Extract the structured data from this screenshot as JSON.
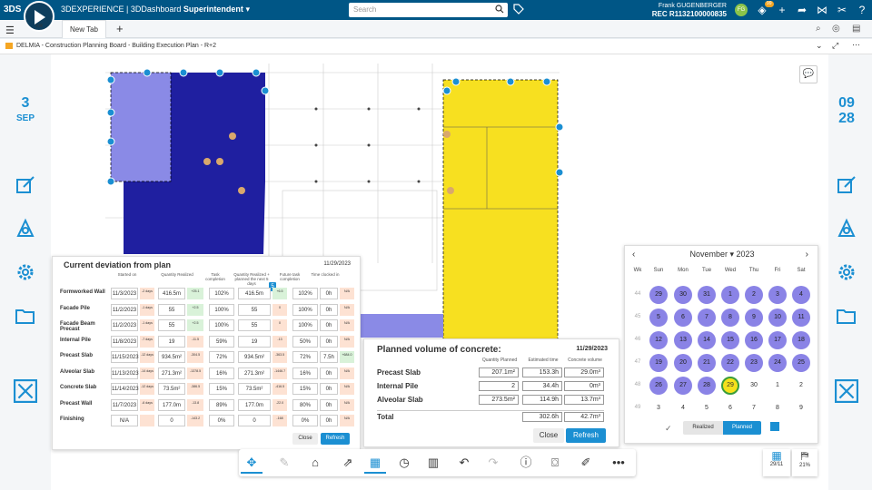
{
  "app": {
    "logo": "3DS",
    "compass_version": "V,R",
    "brand": "3DEXPERIENCE | 3DDashboard",
    "role": "Superintendent",
    "search_placeholder": "Search"
  },
  "user": {
    "name": "Frank GUGENBERGER",
    "rec": "REC R1132100000835",
    "initials": "FG",
    "notifications": "99"
  },
  "tab": {
    "label": "New Tab"
  },
  "dashboard": {
    "title": "DELMIA - Construction Planning Board - Building Execution Plan - R+2"
  },
  "left_date": {
    "day": "3",
    "month": "SEP"
  },
  "right_date": {
    "day": "09",
    "month": "28"
  },
  "deviation": {
    "title": "Current deviation from plan",
    "date": "11/29/2023",
    "headers": [
      "Started on",
      "Quantity Realized",
      "Task completion",
      "Quantity Realized + planned the next 5 days",
      "Future task completion",
      "Time clocked in"
    ],
    "info_badge": "5",
    "rows": [
      {
        "name": "Formworked Wall",
        "start": "11/3/2023",
        "dd": "-2 days",
        "qty": "416.5m",
        "qd": "+25.1",
        "task": "102%",
        "qp": "416.5m",
        "qpd": "+6.5",
        "fut": "102%",
        "time": "0h",
        "td": "N/A"
      },
      {
        "name": "Facade Pile",
        "start": "11/2/2023",
        "dd": "-1 days",
        "qty": "55",
        "qd": "+2.5",
        "task": "100%",
        "qp": "55",
        "qpd": "0",
        "fut": "100%",
        "time": "0h",
        "td": "N/A"
      },
      {
        "name": "Facade Beam Precast",
        "start": "11/2/2023",
        "dd": "-1 days",
        "qty": "55",
        "qd": "+2.5",
        "task": "100%",
        "qp": "55",
        "qpd": "0",
        "fut": "100%",
        "time": "0h",
        "td": "N/A"
      },
      {
        "name": "Internal Pile",
        "start": "11/8/2023",
        "dd": "-7 days",
        "qty": "19",
        "qd": "-11.5",
        "task": "59%",
        "qp": "19",
        "qpd": "-13",
        "fut": "50%",
        "time": "0h",
        "td": "N/A"
      },
      {
        "name": "Precast Slab",
        "start": "11/15/2023",
        "dd": "-12 days",
        "qty": "934.5m²",
        "qd": "-304.5",
        "task": "72%",
        "qp": "934.5m²",
        "qpd": "-363.5",
        "fut": "72%",
        "time": "7.5h",
        "td": "+684.0"
      },
      {
        "name": "Alveolar Slab",
        "start": "11/13/2023",
        "dd": "-14 days",
        "qty": "271.3m²",
        "qd": "-1378.5",
        "task": "16%",
        "qp": "271.3m²",
        "qpd": "-1446.7",
        "fut": "16%",
        "time": "0h",
        "td": "N/A"
      },
      {
        "name": "Concrete Slab",
        "start": "11/14/2023",
        "dd": "-12 days",
        "qty": "73.5m²",
        "qd": "-386.5",
        "task": "15%",
        "qp": "73.5m²",
        "qpd": "-416.5",
        "fut": "15%",
        "time": "0h",
        "td": "N/A"
      },
      {
        "name": "Precast Wall",
        "start": "11/7/2023",
        "dd": "-6 days",
        "qty": "177.0m",
        "qd": "-13.8",
        "task": "89%",
        "qp": "177.0m",
        "qpd": "-22.0",
        "fut": "80%",
        "time": "0h",
        "td": "N/A"
      },
      {
        "name": "Finishing",
        "start": "N/A",
        "dd": "",
        "qty": "0",
        "qd": "-143.2",
        "task": "0%",
        "qp": "0",
        "qpd": "-168",
        "fut": "0%",
        "time": "0h",
        "td": "N/A"
      }
    ],
    "close_label": "Close",
    "refresh_label": "Refresh"
  },
  "volume": {
    "title": "Planned volume of concrete:",
    "date": "11/29/2023",
    "headers": [
      "Quantity Planned",
      "Estimated time",
      "Concrete volume"
    ],
    "rows": [
      {
        "name": "Precast Slab",
        "qty": "207.1m²",
        "time": "153.3h",
        "vol": "29.0m³"
      },
      {
        "name": "Internal Pile",
        "qty": "2",
        "time": "34.4h",
        "vol": "0m³"
      },
      {
        "name": "Alveolar Slab",
        "qty": "273.5m²",
        "time": "114.9h",
        "vol": "13.7m³"
      }
    ],
    "total_label": "Total",
    "total_time": "302.6h",
    "total_vol": "42.7m³",
    "close_label": "Close",
    "refresh_label": "Refresh"
  },
  "calendar": {
    "month": "November",
    "year": "2023",
    "weekday_headers": [
      "Wk",
      "Sun",
      "Mon",
      "Tue",
      "Wed",
      "Thu",
      "Fri",
      "Sat"
    ],
    "weeks": [
      {
        "wk": "44",
        "days": [
          "29",
          "30",
          "31",
          "1",
          "2",
          "3",
          "4"
        ]
      },
      {
        "wk": "45",
        "days": [
          "5",
          "6",
          "7",
          "8",
          "9",
          "10",
          "11"
        ]
      },
      {
        "wk": "46",
        "days": [
          "12",
          "13",
          "14",
          "15",
          "16",
          "17",
          "18"
        ]
      },
      {
        "wk": "47",
        "days": [
          "19",
          "20",
          "21",
          "22",
          "23",
          "24",
          "25"
        ]
      },
      {
        "wk": "48",
        "days": [
          "26",
          "27",
          "28",
          "29",
          "30",
          "1",
          "2"
        ]
      },
      {
        "wk": "49",
        "days": [
          "3",
          "4",
          "5",
          "6",
          "7",
          "8",
          "9"
        ]
      }
    ],
    "realized_label": "Realized",
    "planned_label": "Planned",
    "colors": {
      "active": "#8a83e6",
      "today": "#f5e11c",
      "toggle_active": "#1b8fd2"
    }
  },
  "bottom": {
    "date_label": "29/11",
    "map_label": "21%"
  }
}
